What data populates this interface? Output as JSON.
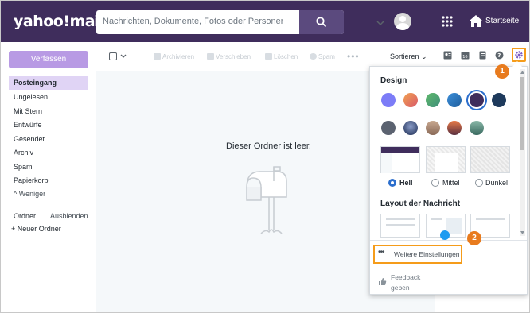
{
  "header": {
    "logo": "yahoo!mail",
    "search_placeholder": "Nachrichten, Dokumente, Fotos oder Personen suchen",
    "home_label": "Startseite"
  },
  "sidebar": {
    "compose_label": "Verfassen",
    "folders": [
      "Posteingang",
      "Ungelesen",
      "Mit Stern",
      "Entwürfe",
      "Gesendet",
      "Archiv",
      "Spam",
      "Papierkorb"
    ],
    "less_label": "Weniger",
    "folders_label": "Ordner",
    "hide_label": "Ausblenden",
    "new_folder_label": "+ Neuer Ordner"
  },
  "toolbar": {
    "archive": "Archivieren",
    "move": "Verschieben",
    "delete": "Löschen",
    "spam": "Spam",
    "sort": "Sortieren"
  },
  "main": {
    "empty_message": "Dieser Ordner ist leer."
  },
  "panel": {
    "design_title": "Design",
    "layout_title": "Layout der Nachricht",
    "theme_options": [
      "Hell",
      "Mittel",
      "Dunkel"
    ],
    "selected_theme": "Hell",
    "more_settings": "Weitere Einstellungen",
    "feedback_line1": "Feedback",
    "feedback_line2": "geben"
  },
  "callouts": {
    "step1": "1",
    "step2": "2"
  },
  "colors": {
    "header_bg": "#3f2d5c",
    "accent": "#b89ae4",
    "highlight": "#f59c1a",
    "badge": "#e87b1e"
  }
}
